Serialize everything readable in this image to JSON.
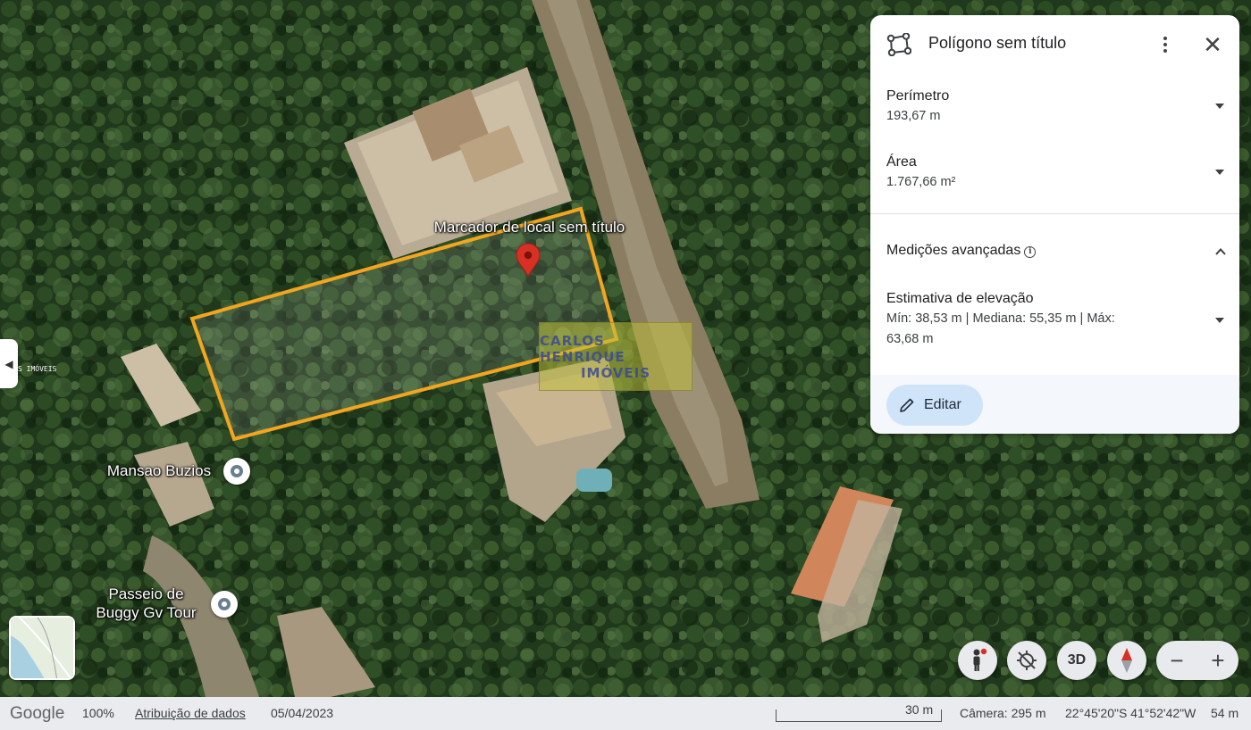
{
  "map": {
    "marker_label": "Marcador de local sem título",
    "places": [
      {
        "name": "Mansao Buzios"
      },
      {
        "name": "Passeio de\nBuggy Gv Tour"
      }
    ],
    "watermark": {
      "line1": "CARLOS HENRIQUE",
      "line2": "IMÓVEIS"
    },
    "side_tab_text": "S IMÓVEIS",
    "polygon_color": "#f2a51f",
    "marker_color": "#d93025"
  },
  "panel": {
    "title": "Polígono sem título",
    "perimeter": {
      "label": "Perímetro",
      "value": "193,67 m"
    },
    "area": {
      "label": "Área",
      "value": "1.767,66 m²"
    },
    "advanced": {
      "label": "Medições avançadas"
    },
    "elevation": {
      "label": "Estimativa de elevação",
      "line1": "Mín: 38,53 m | Mediana: 55,35 m | Máx:",
      "line2": "63,68 m"
    },
    "edit_label": "Editar",
    "icons": [
      "polygon-icon",
      "more-vert-icon",
      "close-icon",
      "chevron-down-icon",
      "chevron-up-icon",
      "info-icon",
      "pencil-icon"
    ]
  },
  "controls": {
    "three_d_label": "3D",
    "zoom_in": "+",
    "zoom_out": "−"
  },
  "status_bar": {
    "logo": "Google",
    "zoom": "100%",
    "attribution": "Atribuição de dados",
    "date": "05/04/2023",
    "scale": "30 m",
    "camera": "Câmera: 295 m",
    "coords": "22°45'20\"S 41°52'42\"W",
    "elevation": "54 m"
  }
}
